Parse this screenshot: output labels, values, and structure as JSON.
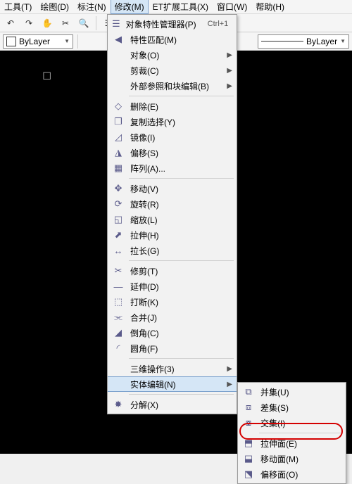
{
  "menubar": {
    "items": [
      "工具(T)",
      "绘图(D)",
      "标注(N)",
      "修改(M)",
      "ET扩展工具(X)",
      "窗口(W)",
      "帮助(H)"
    ],
    "open_index": 3
  },
  "toolbar": {
    "icons": [
      "undo",
      "redo",
      "pan",
      "cut",
      "zoom",
      "sep",
      "layer-props",
      "sep",
      "hatch",
      "table"
    ]
  },
  "layerbar": {
    "color_label": "ByLayer",
    "linetype_label_prefix": "",
    "linetype_label": "ByLayer"
  },
  "menu_modify": {
    "items": [
      {
        "icon": "props",
        "label": "对象特性管理器(P)",
        "shortcut": "Ctrl+1"
      },
      {
        "icon": "match",
        "label": "特性匹配(M)"
      },
      {
        "icon": "",
        "label": "对象(O)",
        "submenu": true
      },
      {
        "icon": "",
        "label": "剪裁(C)",
        "submenu": true
      },
      {
        "icon": "",
        "label": "外部参照和块编辑(B)",
        "submenu": true
      },
      {
        "sep": true
      },
      {
        "icon": "erase",
        "label": "删除(E)"
      },
      {
        "icon": "copy",
        "label": "复制选择(Y)"
      },
      {
        "icon": "mirror",
        "label": "镜像(I)"
      },
      {
        "icon": "offset",
        "label": "偏移(S)"
      },
      {
        "icon": "array",
        "label": "阵列(A)..."
      },
      {
        "sep": true
      },
      {
        "icon": "move",
        "label": "移动(V)"
      },
      {
        "icon": "rotate",
        "label": "旋转(R)"
      },
      {
        "icon": "scale",
        "label": "缩放(L)"
      },
      {
        "icon": "stretch",
        "label": "拉伸(H)"
      },
      {
        "icon": "lengthen",
        "label": "拉长(G)"
      },
      {
        "sep": true
      },
      {
        "icon": "trim",
        "label": "修剪(T)"
      },
      {
        "icon": "extend",
        "label": "延伸(D)"
      },
      {
        "icon": "break",
        "label": "打断(K)"
      },
      {
        "icon": "join",
        "label": "合并(J)"
      },
      {
        "icon": "chamfer",
        "label": "倒角(C)"
      },
      {
        "icon": "fillet",
        "label": "圆角(F)"
      },
      {
        "sep": true
      },
      {
        "icon": "",
        "label": "三维操作(3)",
        "submenu": true
      },
      {
        "icon": "",
        "label": "实体编辑(N)",
        "submenu": true,
        "selected": true
      },
      {
        "sep": true
      },
      {
        "icon": "explode",
        "label": "分解(X)"
      }
    ]
  },
  "menu_solidedit": {
    "items": [
      {
        "icon": "union",
        "label": "并集(U)"
      },
      {
        "icon": "subtract",
        "label": "差集(S)"
      },
      {
        "icon": "intersect",
        "label": "交集(I)"
      },
      {
        "sep": true
      },
      {
        "icon": "extrudeface",
        "label": "拉伸面(E)",
        "highlight": true
      },
      {
        "icon": "moveface",
        "label": "移动面(M)"
      },
      {
        "icon": "offsetface",
        "label": "偏移面(O)"
      }
    ]
  },
  "glyphs": {
    "undo": "↶",
    "redo": "↷",
    "pan": "✋",
    "cut": "✂",
    "zoom": "🔍",
    "layer-props": "☰",
    "hatch": "▦",
    "table": "▥",
    "props": "☰",
    "match": "◀",
    "erase": "◇",
    "copy": "❐",
    "mirror": "◿",
    "offset": "◮",
    "array": "▦",
    "move": "✥",
    "rotate": "⟳",
    "scale": "◱",
    "stretch": "⬈",
    "lengthen": "↔",
    "trim": "✂",
    "extend": "—",
    "break": "⬚",
    "join": "⫘",
    "chamfer": "◢",
    "fillet": "◜",
    "explode": "✸",
    "union": "⧉",
    "subtract": "⧈",
    "intersect": "⧇",
    "extrudeface": "⬒",
    "moveface": "⬓",
    "offsetface": "⬔"
  }
}
